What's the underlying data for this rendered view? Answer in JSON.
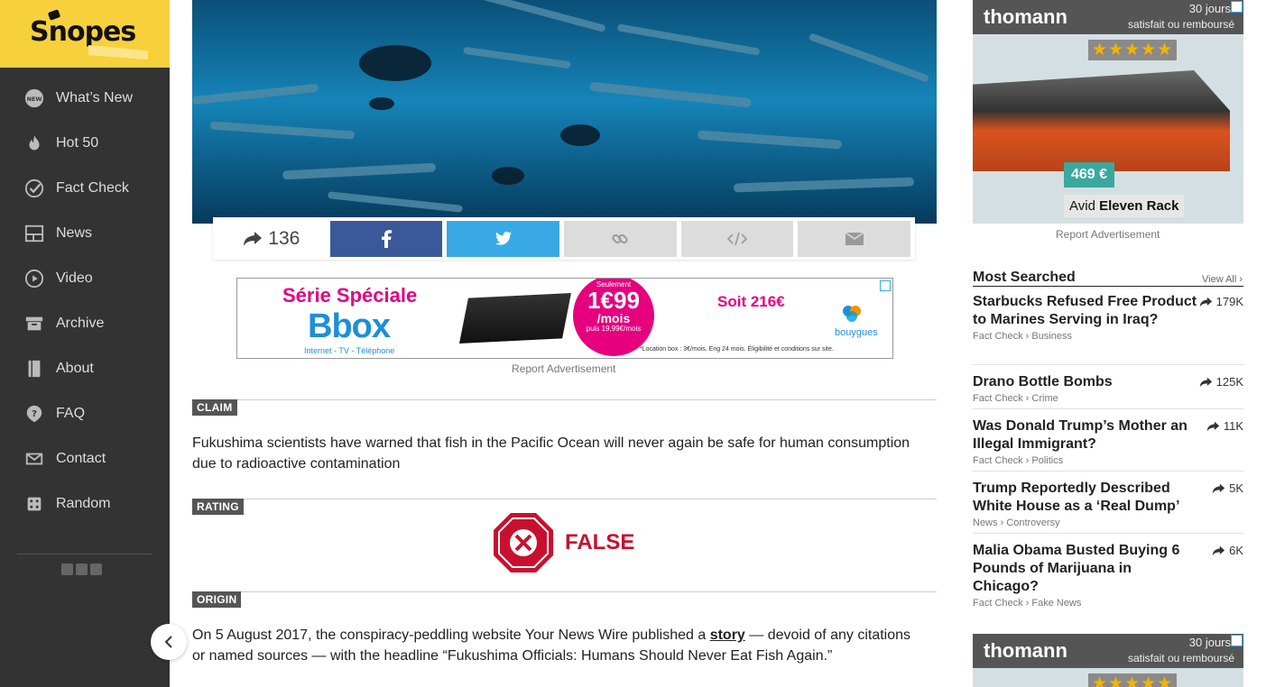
{
  "logo": {
    "text": "Snopes"
  },
  "nav": [
    {
      "label": "What’s New",
      "icon": "new-badge-icon"
    },
    {
      "label": "Hot 50",
      "icon": "flame-icon"
    },
    {
      "label": "Fact Check",
      "icon": "check-circle-icon"
    },
    {
      "label": "News",
      "icon": "news-layout-icon"
    },
    {
      "label": "Video",
      "icon": "play-circle-icon"
    },
    {
      "label": "Archive",
      "icon": "archive-box-icon"
    },
    {
      "label": "About",
      "icon": "notebook-icon"
    },
    {
      "label": "FAQ",
      "icon": "question-icon"
    },
    {
      "label": "Contact",
      "icon": "envelope-icon"
    },
    {
      "label": "Random",
      "icon": "dice-icon"
    }
  ],
  "share": {
    "count": "136"
  },
  "ad_banner": {
    "title": "Série Spéciale",
    "brand_big": "Bbox",
    "sub": "Internet - TV - Téléphone",
    "circle_top": "Seulement",
    "circle_price": "1€99",
    "circle_unit": "/mois",
    "circle_bottom": "puis 19,99€/mois",
    "soit": "Soit 216€",
    "brand": "bouygues",
    "fine": "*Location box : 3€/mois. Eng 24 mois. Éligibilité et conditions sur site."
  },
  "report_ad": "Report Advertisement",
  "claim": {
    "tag": "CLAIM",
    "text": "Fukushima scientists have warned that fish in the Pacific Ocean will never again be safe for human consumption due to radioactive contamination"
  },
  "rating": {
    "tag": "RATING",
    "value": "FALSE"
  },
  "origin": {
    "tag": "ORIGIN",
    "text_before": "On 5 August 2017, the conspiracy-peddling website Your News Wire published a ",
    "link": "story",
    "text_after": " — devoid of any citations or named sources — with the headline “Fukushima Officials: Humans Should Never Eat Fish Again.”"
  },
  "right_ad": {
    "logo": "thomann",
    "days": "30 jours",
    "satisfait": "satisfait ou remboursé",
    "stars": "★★★★★",
    "price": "469 €",
    "product_prefix": "Avid",
    "product_name": "Eleven Rack"
  },
  "most_searched": {
    "title": "Most Searched",
    "view_all": "View All ›",
    "items": [
      {
        "title": "Starbucks Refused Free Product to Marines Serving in Iraq?",
        "meta": "Fact Check › Business",
        "count": "179K"
      },
      {
        "title": "Drano Bottle Bombs",
        "meta": "Fact Check › Crime",
        "count": "125K"
      },
      {
        "title": "Was Donald Trump’s Mother an Illegal Immigrant?",
        "meta": "Fact Check › Politics",
        "count": "11K"
      },
      {
        "title": "Trump Reportedly Described White House as a ‘Real Dump’",
        "meta": "News › Controversy",
        "count": "5K"
      },
      {
        "title": "Malia Obama Busted Buying 6 Pounds of Marijuana in Chicago?",
        "meta": "Fact Check › Fake News",
        "count": "6K"
      }
    ]
  },
  "colors": {
    "accent": "#f7d13c",
    "sidebar": "#333333",
    "facebook": "#3b5998",
    "twitter": "#39a9e5",
    "false_red": "#c8102e"
  }
}
